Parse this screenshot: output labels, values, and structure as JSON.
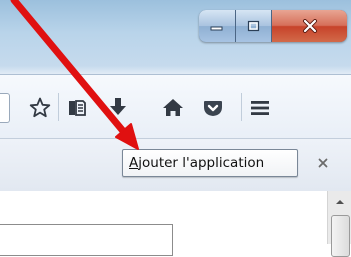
{
  "window": {
    "controls": {
      "minimize_icon": "minimize-icon",
      "maximize_icon": "maximize-icon",
      "close_icon": "close-icon"
    }
  },
  "toolbar": {
    "icons": [
      "star-icon",
      "reading-list-icon",
      "download-icon",
      "home-icon",
      "pocket-icon",
      "menu-icon"
    ]
  },
  "notification": {
    "button_label": "Ajouter l'application",
    "accesskey_char": "A",
    "button_rest": "jouter l'application",
    "close_icon": "close-icon"
  },
  "annotation": {
    "arrow_color": "#e01010"
  },
  "colors": {
    "titlebar": "#b9d4ea",
    "close_button": "#c7432a",
    "toolbar_icons": "#333a44",
    "pocket": "#3b4450"
  }
}
